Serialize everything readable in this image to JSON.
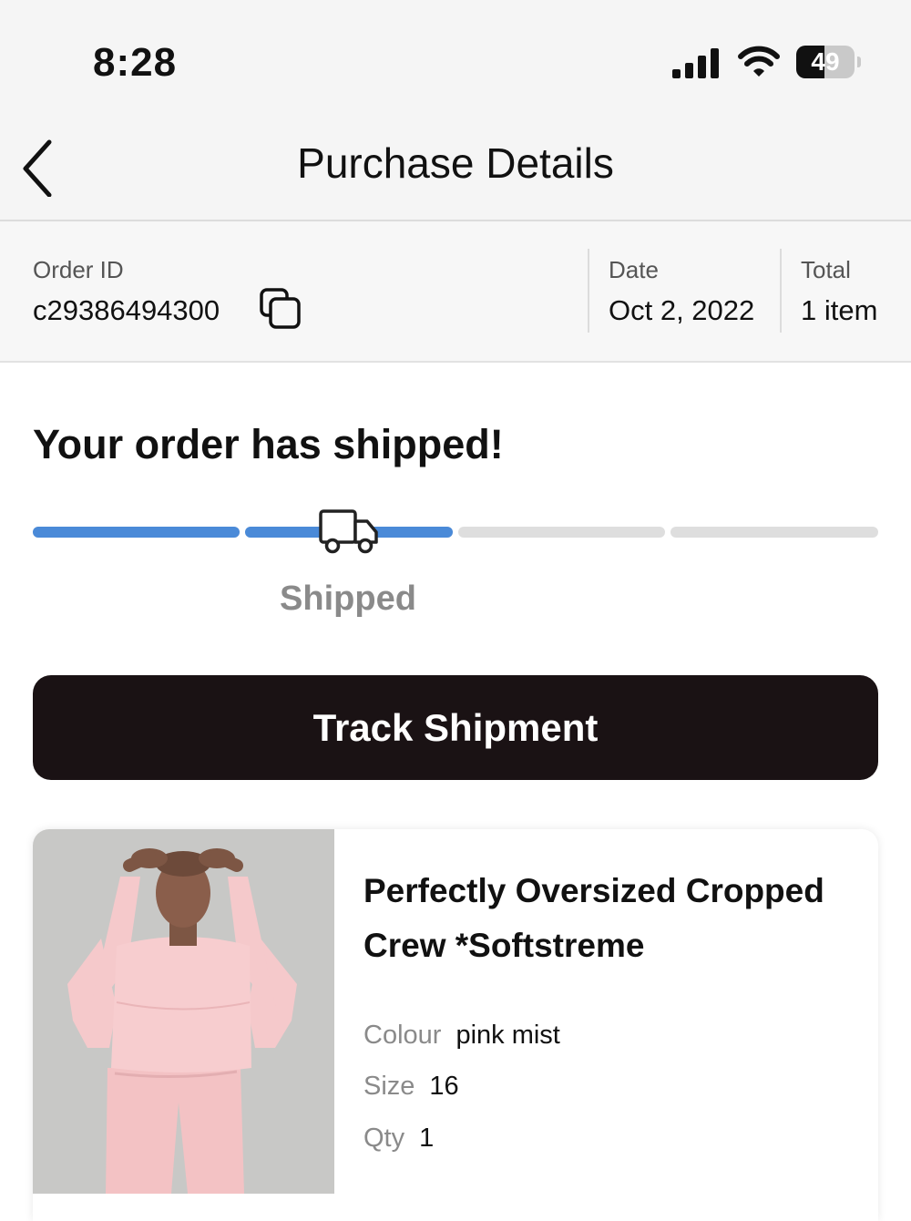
{
  "status_bar": {
    "time": "8:28",
    "signal_icon": "cellular-signal-icon",
    "wifi_icon": "wifi-icon",
    "battery_level": "49",
    "battery_fraction": 0.49
  },
  "nav": {
    "back_icon": "chevron-left-icon",
    "title": "Purchase Details"
  },
  "order": {
    "id_label": "Order ID",
    "id_value": "c29386494300",
    "copy_icon": "copy-icon",
    "date_label": "Date",
    "date_value": "Oct 2, 2022",
    "total_label": "Total",
    "total_value": "1 item"
  },
  "shipment": {
    "heading": "Your order has shipped!",
    "steps_total": 4,
    "steps_completed": 2,
    "current_stage_label": "Shipped",
    "stage_icon": "truck-icon",
    "track_button_label": "Track Shipment"
  },
  "product": {
    "name": "Perfectly Oversized Cropped Crew *Softstreme",
    "colour_label": "Colour",
    "colour_value": "pink mist",
    "size_label": "Size",
    "size_value": "16",
    "qty_label": "Qty",
    "qty_value": "1"
  },
  "colors": {
    "progress_active": "#4a8ad8",
    "progress_inactive": "#dedede",
    "button_bg": "#1a1214",
    "product_pink": "#f5c6c8"
  }
}
